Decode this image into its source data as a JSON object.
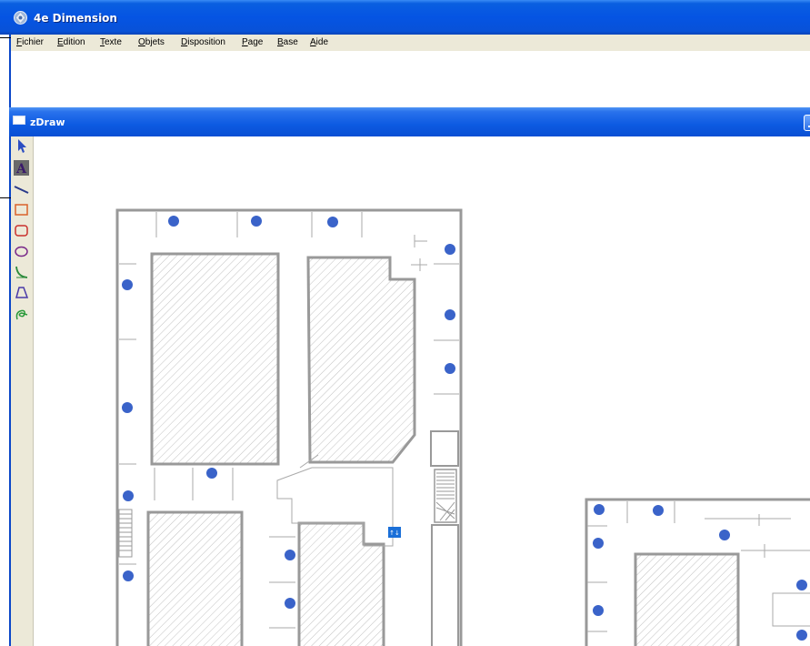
{
  "app": {
    "title": "4e Dimension"
  },
  "menu": [
    {
      "key": "F",
      "rest": "ichier"
    },
    {
      "key": "E",
      "rest": "dition"
    },
    {
      "key": "T",
      "rest": "exte"
    },
    {
      "key": "O",
      "rest": "bjets"
    },
    {
      "key": "D",
      "rest": "isposition"
    },
    {
      "key": "P",
      "rest": "age"
    },
    {
      "key": "B",
      "rest": "ase"
    },
    {
      "key": "A",
      "rest": "ide"
    }
  ],
  "child_window": {
    "title": "zDraw"
  },
  "palette": {
    "tools": [
      {
        "name": "arrow-select-tool-icon"
      },
      {
        "name": "text-tool-icon",
        "glyph": "A"
      },
      {
        "name": "line-tool-icon"
      },
      {
        "name": "rectangle-tool-icon"
      },
      {
        "name": "rounded-rectangle-tool-icon"
      },
      {
        "name": "oval-tool-icon"
      },
      {
        "name": "arc-tool-icon"
      },
      {
        "name": "polygon-tool-icon"
      },
      {
        "name": "freehand-tool-icon"
      }
    ]
  },
  "colors": {
    "titlebar": "#0554e3",
    "menubar": "#ece9d8",
    "plan_wall": "#999999",
    "sensor_dot": "#3a63c9",
    "highlight_marker": "#1a6fd8"
  },
  "drawing": {
    "marker_label": "↑↓"
  }
}
